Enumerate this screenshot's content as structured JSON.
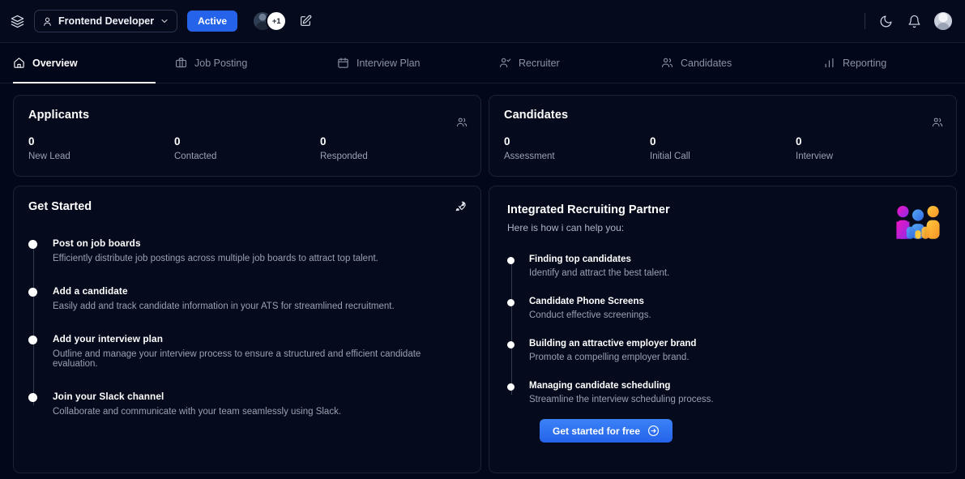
{
  "topbar": {
    "layers_icon": "layers-icon",
    "role_selector": {
      "icon": "user-circle-icon",
      "label": "Frontend Developer",
      "chevron": "chevron-down-icon"
    },
    "status_button": "Active",
    "avatar_overflow": "+1",
    "edit_icon": "edit-square-icon",
    "theme_icon": "moon-icon",
    "notifications_icon": "bell-icon",
    "profile_avatar": "avatar"
  },
  "tabs": [
    {
      "label": "Overview",
      "icon": "home-icon",
      "active": true
    },
    {
      "label": "Job Posting",
      "icon": "briefcase-icon",
      "active": false
    },
    {
      "label": "Interview Plan",
      "icon": "calendar-icon",
      "active": false
    },
    {
      "label": "Recruiter",
      "icon": "user-check-icon",
      "active": false
    },
    {
      "label": "Candidates",
      "icon": "users-icon",
      "active": false
    },
    {
      "label": "Reporting",
      "icon": "bar-chart-icon",
      "active": false
    }
  ],
  "applicants": {
    "title": "Applicants",
    "icon": "users-icon",
    "stats": [
      {
        "value": "0",
        "label": "New Lead"
      },
      {
        "value": "0",
        "label": "Contacted"
      },
      {
        "value": "0",
        "label": "Responded"
      }
    ]
  },
  "candidates": {
    "title": "Candidates",
    "icon": "users-icon",
    "stats": [
      {
        "value": "0",
        "label": "Assessment"
      },
      {
        "value": "0",
        "label": "Initial Call"
      },
      {
        "value": "0",
        "label": "Interview"
      }
    ]
  },
  "get_started": {
    "title": "Get Started",
    "icon": "rocket-icon",
    "items": [
      {
        "title": "Post on job boards",
        "desc": "Efficiently distribute job postings across multiple job boards to attract top talent."
      },
      {
        "title": "Add a candidate",
        "desc": "Easily add and track candidate information in your ATS for streamlined recruitment."
      },
      {
        "title": "Add your interview plan",
        "desc": "Outline and manage your interview process to ensure a structured and efficient candidate evaluation."
      },
      {
        "title": "Join your Slack channel",
        "desc": "Collaborate and communicate with your team seamlessly using Slack."
      }
    ]
  },
  "partner": {
    "title": "Integrated Recruiting Partner",
    "subtitle": "Here is how i can help you:",
    "logo": "people-group-logo",
    "items": [
      {
        "title": "Finding top candidates",
        "desc": "Identify and attract the best talent."
      },
      {
        "title": "Candidate Phone Screens",
        "desc": "Conduct effective screenings."
      },
      {
        "title": "Building an attractive employer brand",
        "desc": "Promote a compelling employer brand."
      },
      {
        "title": "Managing candidate scheduling",
        "desc": "Streamline the interview scheduling process."
      }
    ],
    "cta_label": "Get started for free",
    "cta_icon": "arrow-right-circle-icon"
  },
  "colors": {
    "page_bg": "#03071a",
    "card_bg": "#050a1c",
    "card_border": "#1b2336",
    "accent_blue": "#2563eb",
    "text_primary": "#ffffff",
    "text_muted": "#98a1b3",
    "logo_pink": "#e020b0",
    "logo_blue": "#3b8ef0",
    "logo_orange": "#f9b02c"
  }
}
